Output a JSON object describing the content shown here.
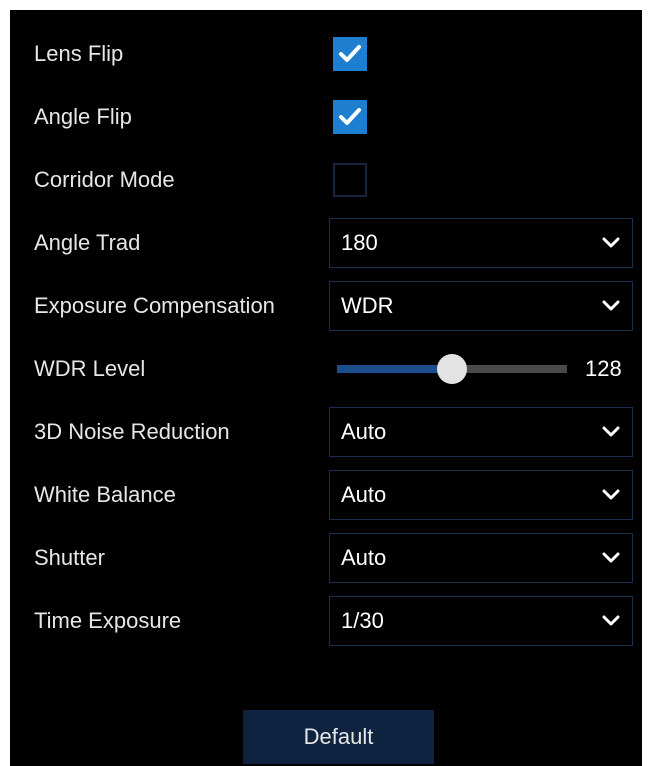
{
  "settings": {
    "lens_flip": {
      "label": "Lens Flip",
      "checked": true
    },
    "angle_flip": {
      "label": "Angle Flip",
      "checked": true
    },
    "corridor_mode": {
      "label": "Corridor Mode",
      "checked": false
    },
    "angle_trad": {
      "label": "Angle Trad",
      "value": "180"
    },
    "exposure_compensation": {
      "label": "Exposure Compensation",
      "value": "WDR"
    },
    "wdr_level": {
      "label": "WDR Level",
      "value": "128",
      "slider_fraction": 0.5
    },
    "noise_reduction": {
      "label": "3D Noise Reduction",
      "value": "Auto"
    },
    "white_balance": {
      "label": "White Balance",
      "value": "Auto"
    },
    "shutter": {
      "label": "Shutter",
      "value": "Auto"
    },
    "time_exposure": {
      "label": "Time Exposure",
      "value": "1/30"
    }
  },
  "buttons": {
    "default_label": "Default"
  },
  "colors": {
    "checkbox_checked": "#1e7fd0",
    "slider_fill": "#1b4d8c",
    "button_bg": "#0d2340"
  }
}
